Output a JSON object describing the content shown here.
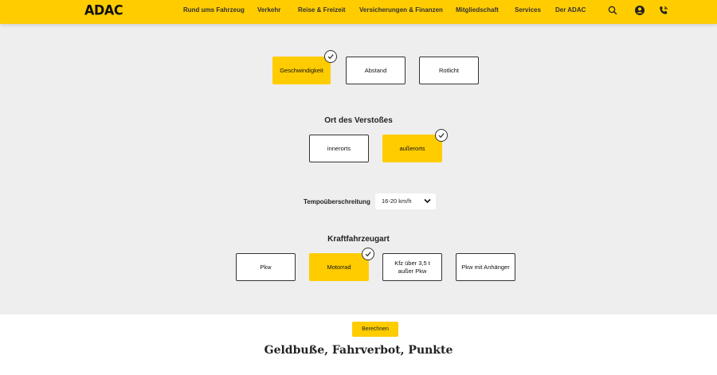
{
  "header": {
    "logo": "ADAC",
    "nav": [
      "Rund ums Fahrzeug",
      "Verkehr",
      "Reise & Freizeit",
      "Versicherungen & Finanzen",
      "Mitgliedschaft",
      "Services",
      "Der ADAC"
    ],
    "icons": [
      "search-icon",
      "account-icon",
      "phone-icon"
    ]
  },
  "violation_type": {
    "options": [
      "Geschwindigkeit",
      "Abstand",
      "Rotlicht"
    ],
    "selected": "Geschwindigkeit"
  },
  "location": {
    "title": "Ort des Verstoßes",
    "options": [
      "innerorts",
      "außerorts"
    ],
    "selected": "außerorts"
  },
  "speed": {
    "label": "Tempoüberschreitung",
    "value": "16-20 km/h"
  },
  "vehicle": {
    "title": "Kraftfahrzeugart",
    "options": [
      "Pkw",
      "Motorrad",
      "Kfz über 3,5 t außer Pkw",
      "Pkw mit Anhänger"
    ],
    "selected": "Motorrad"
  },
  "calculate_button": "Berechnen",
  "result_title": "Geldbuße, Fahrverbot, Punkte",
  "colors": {
    "accent": "#ffcc00",
    "panel": "#eeeeee",
    "border": "#333333"
  }
}
